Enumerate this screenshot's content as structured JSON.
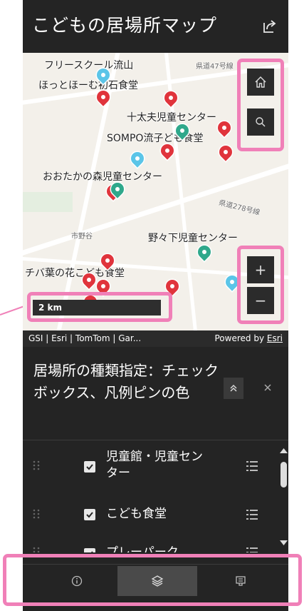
{
  "header": {
    "title": "こどもの居場所マップ",
    "share_icon": "share-icon"
  },
  "map": {
    "places": [
      {
        "id": "free-school",
        "text": "フリースクール流山"
      },
      {
        "id": "prefroad47",
        "text": "県道47号線",
        "small": true
      },
      {
        "id": "hotto",
        "text": "ほっとほーむ初石食堂"
      },
      {
        "id": "jutayu",
        "text": "十太夫児童センター"
      },
      {
        "id": "sompo",
        "text": "SOMPO流子ども食堂"
      },
      {
        "id": "otaka",
        "text": "おおたかの森児童センター"
      },
      {
        "id": "prefroad278",
        "text": "県道278号線",
        "small": true
      },
      {
        "id": "ichinoya",
        "text": "市野谷",
        "small": true
      },
      {
        "id": "nonoshita",
        "text": "野々下児童センター"
      },
      {
        "id": "chiba",
        "text": "チバ葉の花こども食堂"
      }
    ],
    "scale_label": "2 km",
    "attribution": "GSI | Esri | TomTom | Gar...",
    "powered_by": "Powered by",
    "powered_by_link": "Esri",
    "zoom_in": "+",
    "zoom_out": "−"
  },
  "legend": {
    "title": "居場所の種類指定：チェックボックス、凡例ピンの色",
    "items": [
      {
        "label": "児童館・児童センター",
        "checked": true
      },
      {
        "label": "こども食堂",
        "checked": true
      },
      {
        "label": "プレーパーク",
        "checked": true
      }
    ]
  },
  "tabs": [
    {
      "name": "info",
      "icon": "info-icon",
      "active": false
    },
    {
      "name": "layers",
      "icon": "layers-icon",
      "active": true
    },
    {
      "name": "legend",
      "icon": "legend-icon",
      "active": false
    }
  ],
  "colors": {
    "background": "#242424",
    "highlight": "#f080b8",
    "pin_red": "#e0343c",
    "pin_teal": "#2fa88b",
    "pin_sky": "#5bc5e8"
  }
}
